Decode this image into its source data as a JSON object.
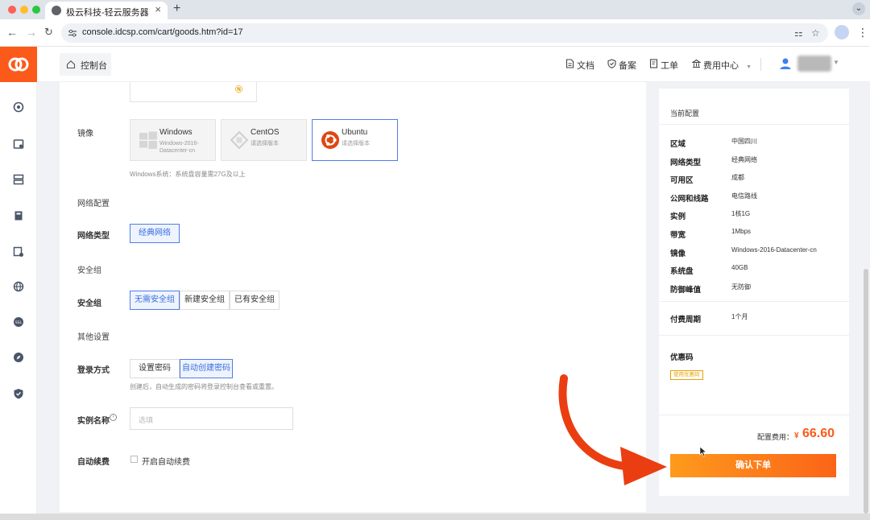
{
  "browser": {
    "tab_title": "极云科技-轻云服务器",
    "tab_close": "×",
    "new_tab": "+",
    "url": "console.idcsp.com/cart/goods.htm?id=17",
    "colors": {
      "close": "#fe5f57",
      "minimize": "#febc2e",
      "maximize": "#28c840"
    }
  },
  "header": {
    "console_label": "控制台",
    "nav": [
      {
        "label": "文档",
        "icon": "doc-icon"
      },
      {
        "label": "备案",
        "icon": "shield-check-icon"
      },
      {
        "label": "工单",
        "icon": "ticket-icon"
      },
      {
        "label": "费用中心",
        "icon": "bank-icon"
      }
    ]
  },
  "sidebar": {
    "icons": [
      "dashboard-icon",
      "server-icon",
      "database-icon",
      "storage-icon",
      "cloud-server-icon",
      "globe-icon",
      "ssl-icon",
      "compass-icon",
      "security-shield-icon"
    ],
    "ssl_text": "SSL"
  },
  "form": {
    "image_label": "镜像",
    "images": [
      {
        "name": "Windows",
        "sub": "Windows-2016-Datacenter-cn",
        "icon": "windows-icon",
        "selected": false
      },
      {
        "name": "CentOS",
        "sub": "请选择版本",
        "icon": "centos-icon",
        "selected": false
      },
      {
        "name": "Ubuntu",
        "sub": "请选择版本",
        "icon": "ubuntu-icon",
        "selected": true
      }
    ],
    "image_hint": "Windows系统：系统盘容量需27G及以上",
    "network_section": "网络配置",
    "network_type_label": "网络类型",
    "network_type_option": "经典网络",
    "security_section": "安全组",
    "security_label": "安全组",
    "security_options": [
      "无需安全组",
      "新建安全组",
      "已有安全组"
    ],
    "other_section": "其他设置",
    "login_label": "登录方式",
    "login_options": [
      "设置密码",
      "自动创建密码"
    ],
    "login_hint": "创建后，自动生成的密码将登录控制台查看或重置。",
    "instance_name_label": "实例名称",
    "instance_name_placeholder": "选填",
    "info_icon_text": "i",
    "auto_renew_label": "自动续费",
    "auto_renew_option": "开启自动续费"
  },
  "summary": {
    "title": "当前配置",
    "rows": [
      {
        "k": "区域",
        "v": "中国四川"
      },
      {
        "k": "网络类型",
        "v": "经典网络"
      },
      {
        "k": "可用区",
        "v": "成都"
      },
      {
        "k": "公网和线路",
        "v": "电信路线"
      },
      {
        "k": "实例",
        "v": "1核1G"
      },
      {
        "k": "带宽",
        "v": "1Mbps"
      },
      {
        "k": "镜像",
        "v": "Windows-2016-Datacenter-cn"
      },
      {
        "k": "系统盘",
        "v": "40GB"
      },
      {
        "k": "防御峰值",
        "v": "无防御"
      }
    ],
    "period_label": "付费周期",
    "period_value": "1个月",
    "coupon_label": "优惠码",
    "coupon_button": "使用优惠码",
    "fee_label": "配置费用：",
    "fee_currency": "¥",
    "fee_value": "66.60",
    "confirm_button": "确认下单"
  },
  "colors": {
    "accent": "#fb5a1a",
    "link_blue": "#3a6fe0",
    "arrow": "#ea3e12"
  }
}
